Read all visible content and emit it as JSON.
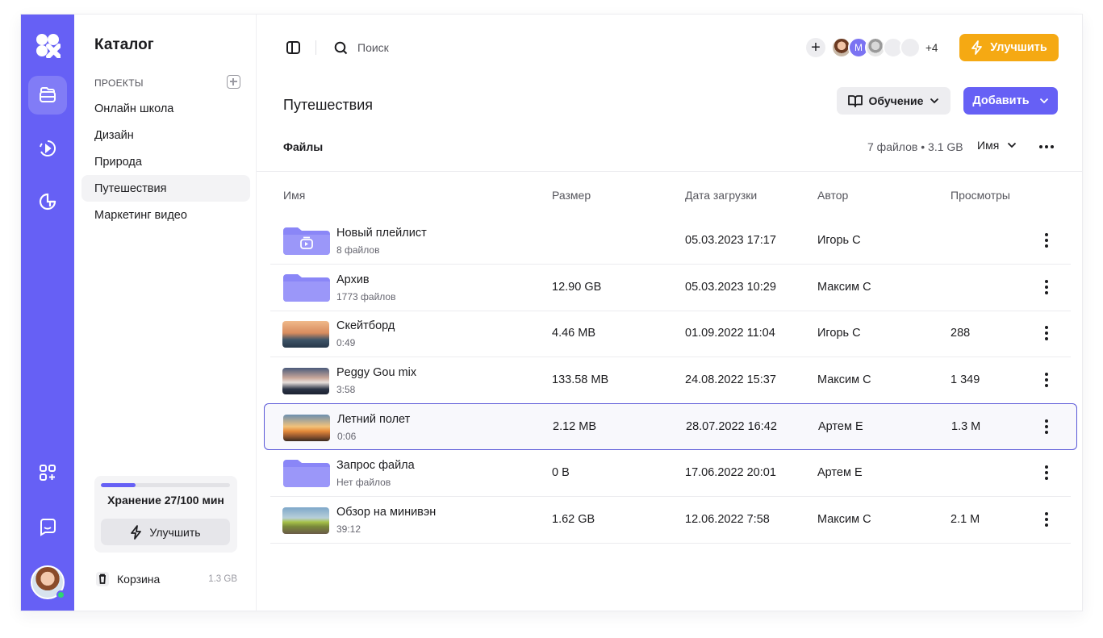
{
  "catalog": {
    "title": "Каталог",
    "projects_label": "ПРОЕКТЫ",
    "projects": [
      "Онлайн школа",
      "Дизайн",
      "Природа",
      "Путешествия",
      "Маркетинг видео"
    ],
    "active_project": "Путешествия",
    "storage": {
      "label": "Хранение 27/100 мин",
      "used_fraction": 0.27,
      "upgrade_label": "Улучшить"
    },
    "trash": {
      "label": "Корзина",
      "size": "1.3 GB"
    }
  },
  "topbar": {
    "search_placeholder": "Поиск",
    "collaborators_more": "+4",
    "collaborator_initial": "M",
    "upgrade_label": "Улучшить"
  },
  "page": {
    "title": "Путешествия",
    "learn_label": "Обучение",
    "add_label": "Добавить",
    "files_label": "Файлы",
    "files_meta": "7 файлов • 3.1 GB",
    "sort_label": "Имя"
  },
  "table": {
    "columns": [
      "Имя",
      "Размер",
      "Дата загрузки",
      "Автор",
      "Просмотры"
    ],
    "rows": [
      {
        "type": "playlist-folder",
        "name": "Новый плейлист",
        "sub": "8 файлов",
        "size": "",
        "date": "05.03.2023 17:17",
        "author": "Игорь С",
        "views": ""
      },
      {
        "type": "folder",
        "name": "Архив",
        "sub": "1773 файлов",
        "size": "12.90 GB",
        "date": "05.03.2023 10:29",
        "author": "Максим С",
        "views": ""
      },
      {
        "type": "video",
        "name": "Скейтборд",
        "sub": "0:49",
        "size": "4.46 MB",
        "date": "01.09.2022 11:04",
        "author": "Игорь С",
        "views": "288"
      },
      {
        "type": "video",
        "name": "Peggy Gou mix",
        "sub": "3:58",
        "size": "133.58 MB",
        "date": "24.08.2022 15:37",
        "author": "Максим С",
        "views": "1 349"
      },
      {
        "type": "video",
        "name": "Летний полет",
        "sub": "0:06",
        "size": "2.12 MB",
        "date": "28.07.2022 16:42",
        "author": "Артем Е",
        "views": "1.3 M",
        "selected": true
      },
      {
        "type": "folder",
        "name": "Запрос файла",
        "sub": "Нет файлов",
        "size": "0 B",
        "date": "17.06.2022 20:01",
        "author": "Артем Е",
        "views": ""
      },
      {
        "type": "video",
        "name": "Обзор на минивэн",
        "sub": "39:12",
        "size": "1.62 GB",
        "date": "12.06.2022 7:58",
        "author": "Максим С",
        "views": "2.1 M"
      }
    ]
  },
  "colors": {
    "accent": "#6660f5",
    "upgrade": "#f5a913",
    "folder": "#8a86f7",
    "selection": "#5a58d8"
  },
  "icons": {
    "rail": [
      "logo-icon",
      "folders-icon",
      "broadcast-icon",
      "analytics-icon",
      "apps-add-icon",
      "chat-icon"
    ],
    "topbar": [
      "sidebar-toggle-icon",
      "search-icon",
      "plus-icon",
      "bolt-icon"
    ]
  }
}
